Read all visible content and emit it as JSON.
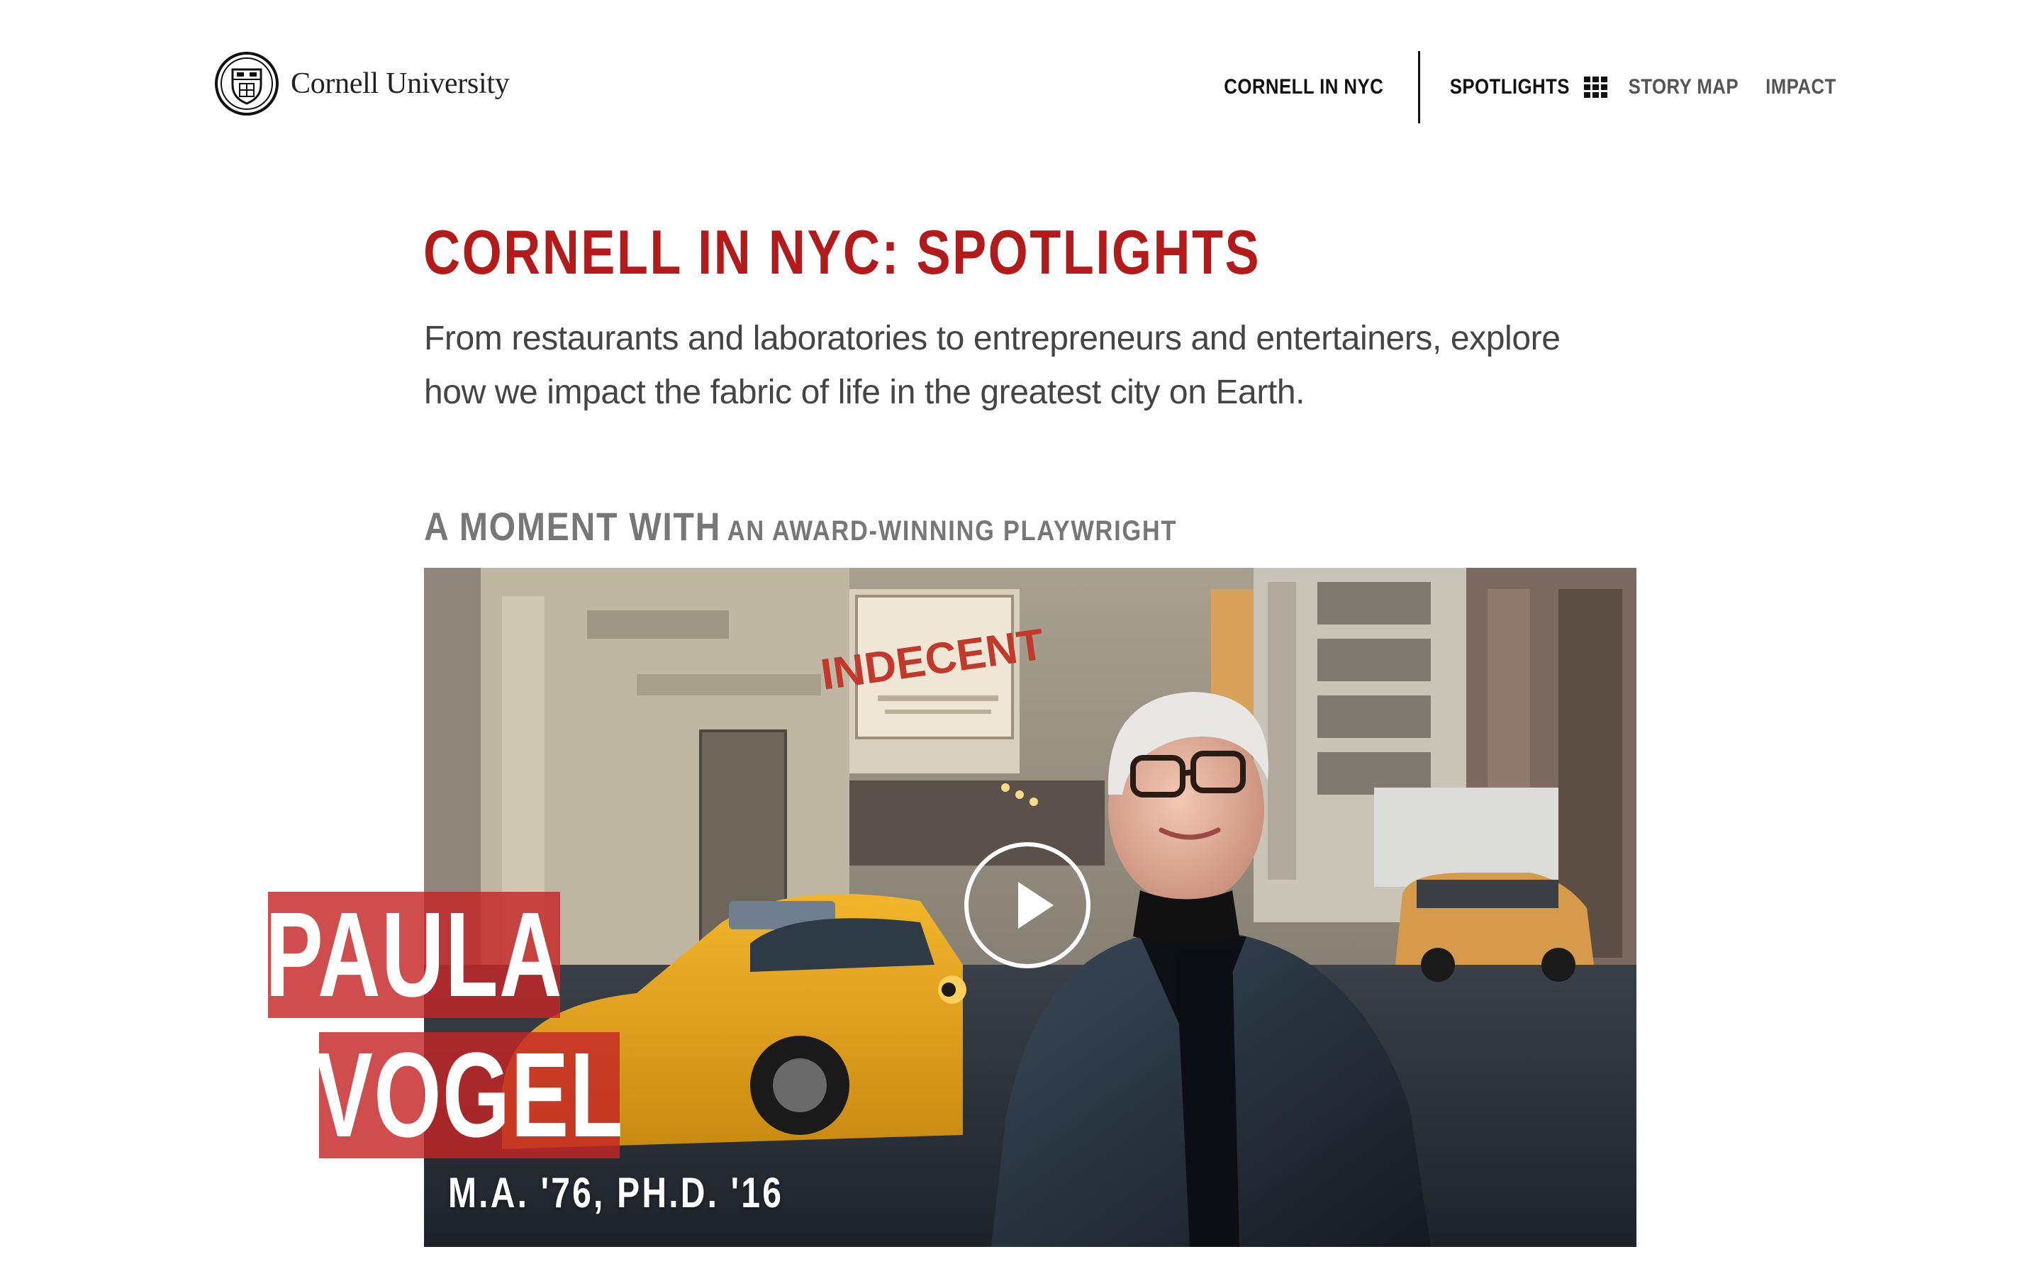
{
  "header": {
    "logo_text": "Cornell University",
    "nav": {
      "main": "CORNELL IN NYC",
      "spotlights": "SPOTLIGHTS",
      "grid_icon": "grid-icon",
      "story_map": "STORY MAP",
      "impact": "IMPACT"
    }
  },
  "hero": {
    "title": "CORNELL IN NYC: SPOTLIGHTS",
    "intro": "From restaurants and laboratories to entrepreneurs and entertainers, explore how we impact the fabric of life in the greatest city on Earth."
  },
  "section": {
    "kicker_big": "A MOMENT WITH",
    "kicker_small": "AN AWARD-WINNING PLAYWRIGHT"
  },
  "feature": {
    "first_name": "PAULA",
    "last_name": "VOGEL",
    "credentials": "M.A. '76, PH.D. '16",
    "marquee_text": "INDECENT",
    "play_icon": "play-icon"
  },
  "colors": {
    "brand_red": "#b31b1b",
    "name_block_red": "#c42626",
    "nav_text": "#111111",
    "nav_light_text": "#555555",
    "kicker_gray": "#777777",
    "body_text": "#444444"
  }
}
